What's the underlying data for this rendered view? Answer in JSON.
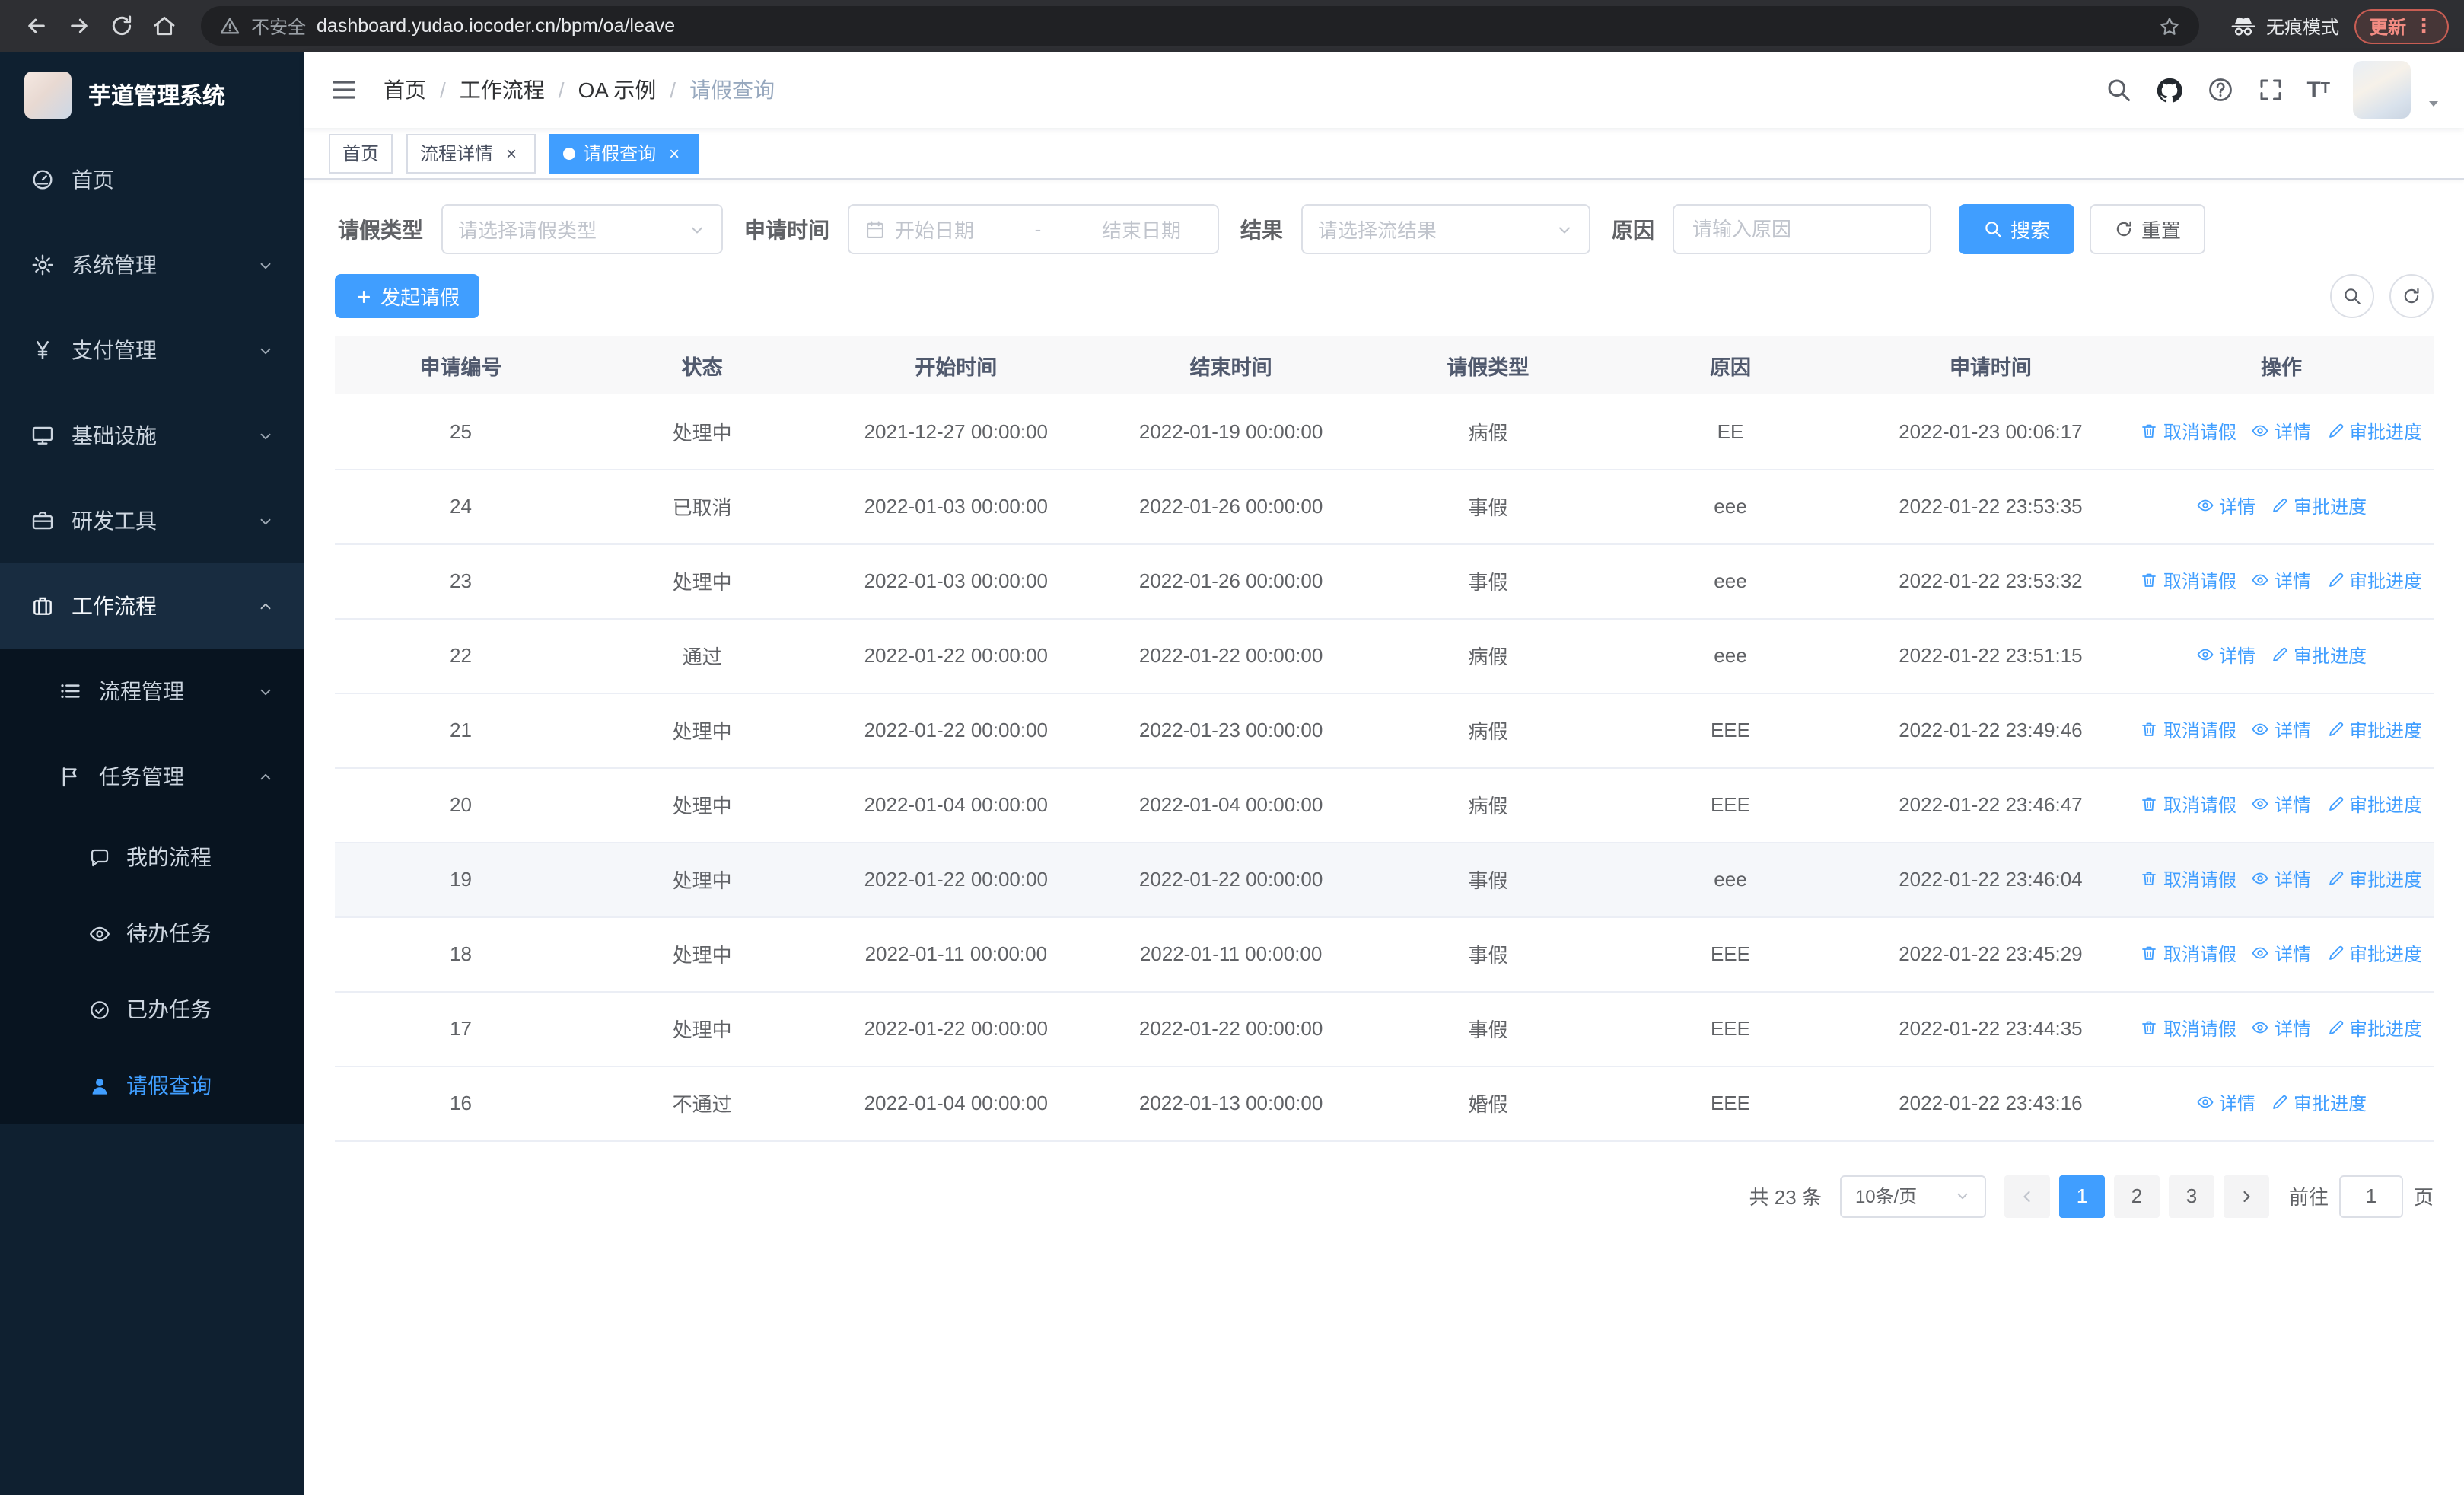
{
  "browser": {
    "security_label": "不安全",
    "url": "dashboard.yudao.iocoder.cn/bpm/oa/leave",
    "incognito_label": "无痕模式",
    "update_label": "更新"
  },
  "sidebar": {
    "logo_title": "芋道管理系统",
    "items": [
      {
        "id": "home",
        "label": "首页",
        "icon": "dashboard-icon",
        "glyph": "i-gauge",
        "arrow": "",
        "open": false
      },
      {
        "id": "system",
        "label": "系统管理",
        "icon": "gear-icon",
        "glyph": "i-gear",
        "arrow": "down",
        "open": false
      },
      {
        "id": "payment",
        "label": "支付管理",
        "icon": "yen-icon",
        "glyph": "i-yen",
        "arrow": "down",
        "open": false
      },
      {
        "id": "infrastructure",
        "label": "基础设施",
        "icon": "monitor-icon",
        "glyph": "i-monitor",
        "arrow": "down",
        "open": false
      },
      {
        "id": "devtools",
        "label": "研发工具",
        "icon": "briefcase-icon",
        "glyph": "i-briefcase",
        "arrow": "down",
        "open": false
      },
      {
        "id": "workflow",
        "label": "工作流程",
        "icon": "suitcase-icon",
        "glyph": "i-suitcase",
        "arrow": "up",
        "open": true
      }
    ],
    "sub_items": [
      {
        "id": "process-mgmt",
        "label": "流程管理",
        "icon": "list-icon",
        "glyph": "i-list",
        "arrow": "down"
      },
      {
        "id": "task-mgmt",
        "label": "任务管理",
        "icon": "flag-icon",
        "glyph": "i-flag",
        "arrow": "up"
      }
    ],
    "task_items": [
      {
        "id": "my-process",
        "label": "我的流程",
        "icon": "chat-icon",
        "glyph": "i-chat",
        "active": false
      },
      {
        "id": "todo-tasks",
        "label": "待办任务",
        "icon": "eye-icon",
        "glyph": "i-eye",
        "active": false
      },
      {
        "id": "done-tasks",
        "label": "已办任务",
        "icon": "check-circle-icon",
        "glyph": "i-check",
        "active": false
      },
      {
        "id": "leave-query",
        "label": "请假查询",
        "icon": "user-icon",
        "glyph": "i-user",
        "active": true
      }
    ]
  },
  "navbar": {
    "breadcrumb": [
      "首页",
      "工作流程",
      "OA 示例",
      "请假查询"
    ]
  },
  "tabs": [
    {
      "id": "home",
      "label": "首页",
      "active": false,
      "closable": false
    },
    {
      "id": "process-detail",
      "label": "流程详情",
      "active": false,
      "closable": true
    },
    {
      "id": "leave-query",
      "label": "请假查询",
      "active": true,
      "closable": true
    }
  ],
  "filters": {
    "type_label": "请假类型",
    "type_placeholder": "请选择请假类型",
    "time_label": "申请时间",
    "start_placeholder": "开始日期",
    "range_separator": "-",
    "end_placeholder": "结束日期",
    "result_label": "结果",
    "result_placeholder": "请选择流结果",
    "reason_label": "原因",
    "reason_placeholder": "请输入原因",
    "search_label": "搜索",
    "reset_label": "重置"
  },
  "toolbar": {
    "create_label": "发起请假"
  },
  "table": {
    "columns": [
      "申请编号",
      "状态",
      "开始时间",
      "结束时间",
      "请假类型",
      "原因",
      "申请时间",
      "操作"
    ],
    "action_labels": {
      "cancel": "取消请假",
      "detail": "详情",
      "progress": "审批进度"
    },
    "rows": [
      {
        "id": "25",
        "status": "处理中",
        "start": "2021-12-27 00:00:00",
        "end": "2022-01-19 00:00:00",
        "type": "病假",
        "reason": "EE",
        "applied": "2022-01-23 00:06:17",
        "actions": [
          "cancel",
          "detail",
          "progress"
        ],
        "hover": false
      },
      {
        "id": "24",
        "status": "已取消",
        "start": "2022-01-03 00:00:00",
        "end": "2022-01-26 00:00:00",
        "type": "事假",
        "reason": "eee",
        "applied": "2022-01-22 23:53:35",
        "actions": [
          "detail",
          "progress"
        ],
        "hover": false
      },
      {
        "id": "23",
        "status": "处理中",
        "start": "2022-01-03 00:00:00",
        "end": "2022-01-26 00:00:00",
        "type": "事假",
        "reason": "eee",
        "applied": "2022-01-22 23:53:32",
        "actions": [
          "cancel",
          "detail",
          "progress"
        ],
        "hover": false
      },
      {
        "id": "22",
        "status": "通过",
        "start": "2022-01-22 00:00:00",
        "end": "2022-01-22 00:00:00",
        "type": "病假",
        "reason": "eee",
        "applied": "2022-01-22 23:51:15",
        "actions": [
          "detail",
          "progress"
        ],
        "hover": false
      },
      {
        "id": "21",
        "status": "处理中",
        "start": "2022-01-22 00:00:00",
        "end": "2022-01-23 00:00:00",
        "type": "病假",
        "reason": "EEE",
        "applied": "2022-01-22 23:49:46",
        "actions": [
          "cancel",
          "detail",
          "progress"
        ],
        "hover": false
      },
      {
        "id": "20",
        "status": "处理中",
        "start": "2022-01-04 00:00:00",
        "end": "2022-01-04 00:00:00",
        "type": "病假",
        "reason": "EEE",
        "applied": "2022-01-22 23:46:47",
        "actions": [
          "cancel",
          "detail",
          "progress"
        ],
        "hover": false
      },
      {
        "id": "19",
        "status": "处理中",
        "start": "2022-01-22 00:00:00",
        "end": "2022-01-22 00:00:00",
        "type": "事假",
        "reason": "eee",
        "applied": "2022-01-22 23:46:04",
        "actions": [
          "cancel",
          "detail",
          "progress"
        ],
        "hover": true
      },
      {
        "id": "18",
        "status": "处理中",
        "start": "2022-01-11 00:00:00",
        "end": "2022-01-11 00:00:00",
        "type": "事假",
        "reason": "EEE",
        "applied": "2022-01-22 23:45:29",
        "actions": [
          "cancel",
          "detail",
          "progress"
        ],
        "hover": false
      },
      {
        "id": "17",
        "status": "处理中",
        "start": "2022-01-22 00:00:00",
        "end": "2022-01-22 00:00:00",
        "type": "事假",
        "reason": "EEE",
        "applied": "2022-01-22 23:44:35",
        "actions": [
          "cancel",
          "detail",
          "progress"
        ],
        "hover": false
      },
      {
        "id": "16",
        "status": "不通过",
        "start": "2022-01-04 00:00:00",
        "end": "2022-01-13 00:00:00",
        "type": "婚假",
        "reason": "EEE",
        "applied": "2022-01-22 23:43:16",
        "actions": [
          "detail",
          "progress"
        ],
        "hover": false
      }
    ]
  },
  "pagination": {
    "total_label": "共 23 条",
    "page_size_value": "10条/页",
    "pages": [
      "1",
      "2",
      "3"
    ],
    "active_page": "1",
    "goto_label": "前往",
    "goto_value": "1",
    "unit_label": "页"
  },
  "colors": {
    "primary": "#409eff"
  }
}
